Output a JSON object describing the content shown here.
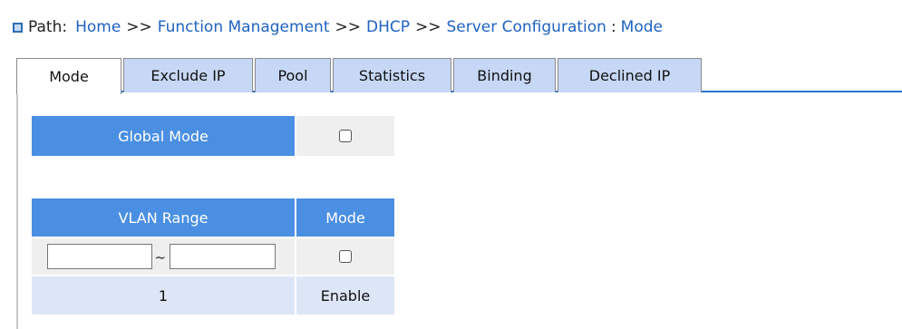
{
  "breadcrumb": {
    "label": "Path:",
    "items": [
      "Home",
      "Function Management",
      "DHCP",
      "Server Configuration"
    ],
    "separator": ">>",
    "current_sep": ":",
    "current": "Mode"
  },
  "tabs": [
    {
      "label": "Mode",
      "active": true
    },
    {
      "label": "Exclude IP",
      "active": false
    },
    {
      "label": "Pool",
      "active": false
    },
    {
      "label": "Statistics",
      "active": false
    },
    {
      "label": "Binding",
      "active": false
    },
    {
      "label": "Declined IP",
      "active": false
    }
  ],
  "global_mode": {
    "label": "Global Mode",
    "checked": false
  },
  "vlan_table": {
    "headers": [
      "VLAN Range",
      "Mode"
    ],
    "input_row": {
      "from_value": "",
      "separator": "~",
      "to_value": "",
      "checked": false
    },
    "rows": [
      {
        "vlan": "1",
        "mode": "Enable"
      }
    ]
  },
  "colors": {
    "header_blue": "#4a8fe2",
    "tab_bg": "#c7d8f6",
    "link": "#1f62c1"
  }
}
